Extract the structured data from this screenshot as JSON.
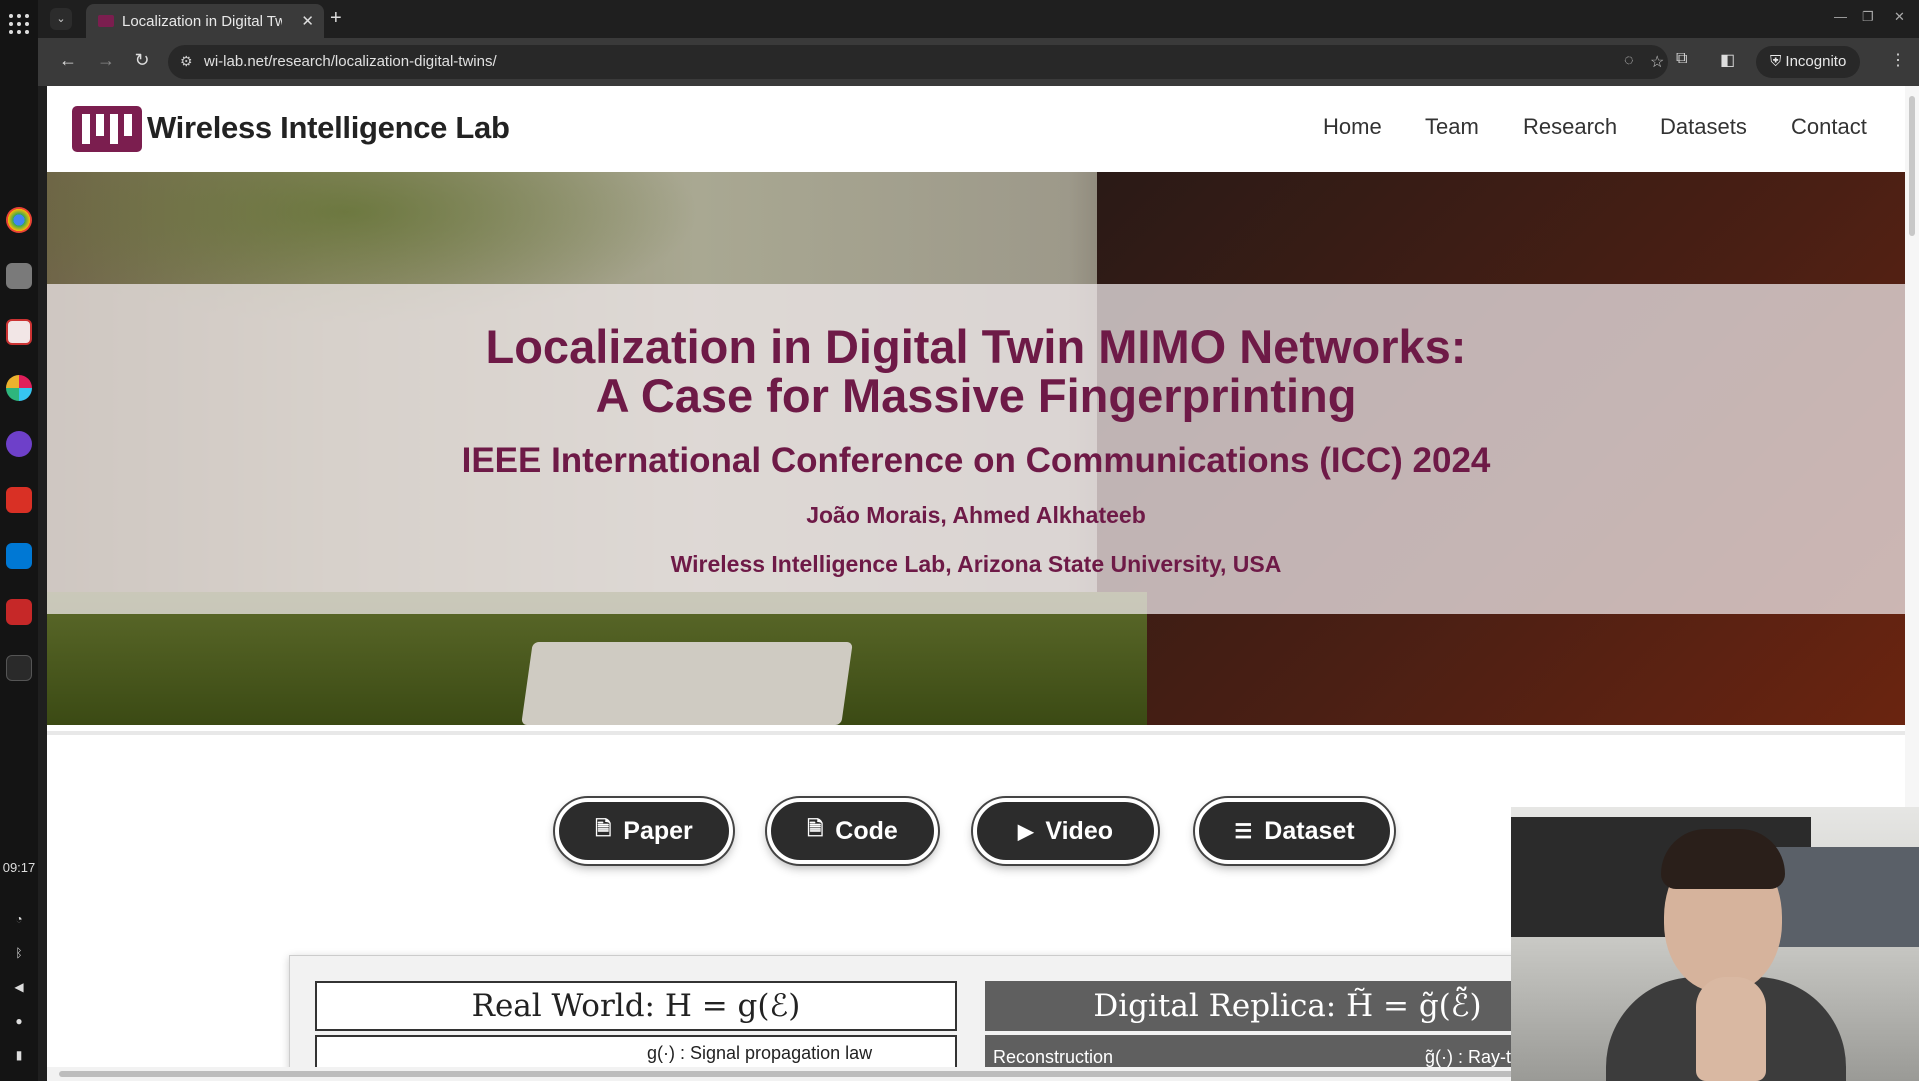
{
  "browser": {
    "tab_title": "Localization in Digital Tw",
    "url": "wi-lab.net/research/localization-digital-twins/",
    "incognito_label": "Incognito"
  },
  "os": {
    "clock": "09:17"
  },
  "site": {
    "logo_text": "Wireless Intelligence Lab",
    "nav": [
      "Home",
      "Team",
      "Research",
      "Datasets",
      "Contact"
    ]
  },
  "hero": {
    "title_line1": "Localization in Digital Twin MIMO Networks:",
    "title_line2": "A Case for Massive Fingerprinting",
    "conference": "IEEE International Conference on Communications (ICC) 2024",
    "authors": "João Morais, Ahmed Alkhateeb",
    "affiliation": "Wireless Intelligence Lab, Arizona State University, USA"
  },
  "links": {
    "paper": "Paper",
    "code": "Code",
    "video": "Video",
    "dataset": "Dataset"
  },
  "figure": {
    "real_world": "Real World: H = g(ℰ)",
    "real_world_sub": "g(·) : Signal propagation law",
    "digital_replica": "Digital Replica: H̃ = g̃(ℰ̃)",
    "digital_replica_sub_left": "Reconstruction",
    "digital_replica_sub_right": "g̃(·) : Ray-t"
  },
  "colors": {
    "brand": "#7b1e4f",
    "hero_text": "#6e1a47",
    "button_bg": "#2c2c2c"
  }
}
